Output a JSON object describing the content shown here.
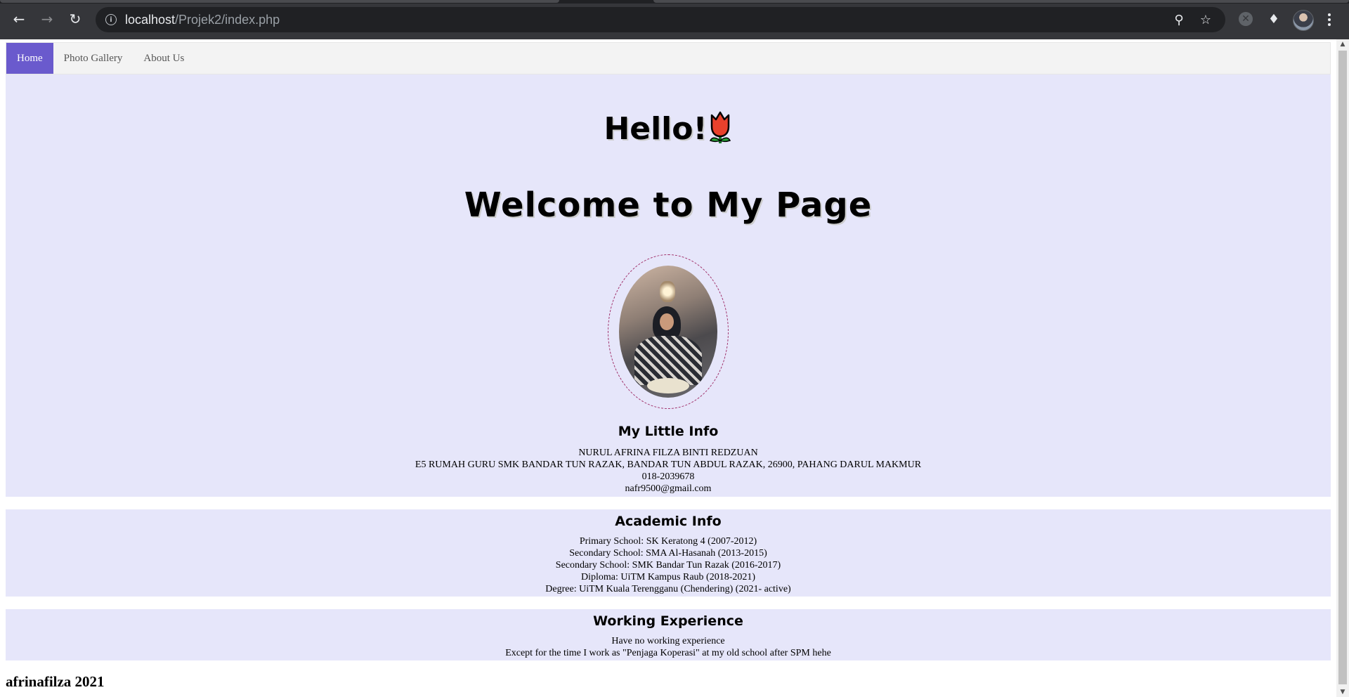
{
  "browser": {
    "url_host": "localhost",
    "url_path": "/Projek2/index.php"
  },
  "nav": {
    "items": [
      {
        "label": "Home",
        "active": true
      },
      {
        "label": "Photo Gallery",
        "active": false
      },
      {
        "label": "About Us",
        "active": false
      }
    ]
  },
  "hero": {
    "hello": "Hello!",
    "welcome": "Welcome to My Page"
  },
  "little_info": {
    "title": "My Little Info",
    "lines": [
      "NURUL AFRINA FILZA BINTI REDZUAN",
      "E5 RUMAH GURU SMK BANDAR TUN RAZAK, BANDAR TUN ABDUL RAZAK, 26900, PAHANG DARUL MAKMUR",
      "018-2039678",
      "nafr9500@gmail.com"
    ]
  },
  "academic_info": {
    "title": "Academic Info",
    "lines": [
      "Primary School: SK Keratong 4 (2007-2012)",
      "Secondary School: SMA Al-Hasanah (2013-2015)",
      "Secondary School: SMK Bandar Tun Razak (2016-2017)",
      "Diploma: UiTM Kampus Raub (2018-2021)",
      "Degree: UiTM Kuala Terengganu (Chendering) (2021- active)"
    ]
  },
  "working_experience": {
    "title": "Working Experience",
    "lines": [
      "Have no working experience",
      "Except for the time I work as \"Penjaga Koperasi\" at my old school after SPM hehe"
    ]
  },
  "footer": {
    "text": "afrinafilza 2021"
  },
  "colors": {
    "nav_active": "#6a5acd",
    "section_bg": "#e6e6fa"
  }
}
